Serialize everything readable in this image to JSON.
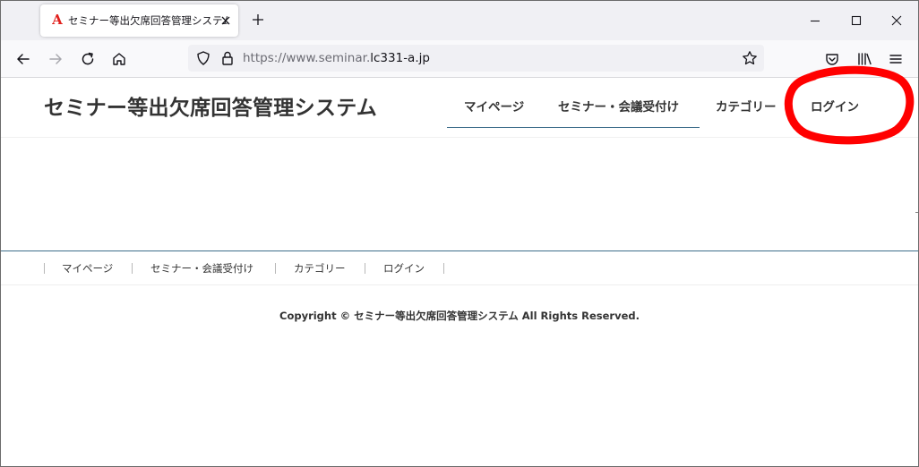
{
  "browser": {
    "tab": {
      "favicon_glyph": "A",
      "favicon_color": "#e1201c",
      "title": "セミナー等出欠席回答管理システム"
    },
    "url": {
      "prefix": "https://www.seminar.",
      "domain": "lc331-a.jp"
    }
  },
  "site": {
    "title": "セミナー等出欠席回答管理システム",
    "nav": [
      {
        "label": "マイページ"
      },
      {
        "label": "セミナー・会議受付け"
      },
      {
        "label": "カテゴリー"
      },
      {
        "label": "ログイン"
      }
    ],
    "footer_nav": [
      {
        "label": "マイページ"
      },
      {
        "label": "セミナー・会議受付け"
      },
      {
        "label": "カテゴリー"
      },
      {
        "label": "ログイン"
      }
    ],
    "copyright": "Copyright © セミナー等出欠席回答管理システム All Rights Reserved.",
    "accent_color": "#3d6d8a"
  },
  "annotation": {
    "color": "#ff0000",
    "target": "login"
  }
}
